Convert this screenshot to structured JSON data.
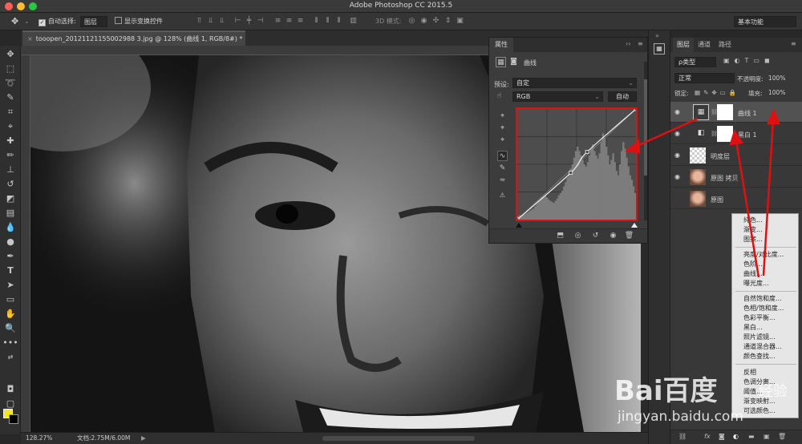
{
  "window": {
    "title": "Adobe Photoshop CC 2015.5"
  },
  "options_bar": {
    "auto_select_label": "自动选择:",
    "auto_select_value": "图层",
    "show_transform_label": "显示变换控件",
    "mode3d_label": "3D 模式:",
    "workspace": "基本功能"
  },
  "document": {
    "tab_title": "tooopen_20121121155002988 3.jpg @ 128% (曲线 1, RGB/8#) *",
    "zoom": "128.27%",
    "doc_size": "文档:2.75M/6.00M"
  },
  "properties": {
    "tab": "属性",
    "header": "曲线",
    "preset_label": "预设:",
    "preset_value": "自定",
    "channel": "RGB",
    "auto_button": "自动",
    "histogram": [
      3,
      4,
      4,
      5,
      5,
      6,
      7,
      8,
      9,
      10,
      12,
      14,
      16,
      18,
      20,
      21,
      22,
      20,
      18,
      17,
      16,
      15,
      17,
      19,
      22,
      24,
      26,
      30,
      34,
      38,
      42,
      46,
      50,
      56,
      62,
      66,
      62,
      58,
      54,
      50,
      48,
      52,
      58,
      64,
      68,
      62,
      58,
      55,
      60,
      70,
      78,
      74,
      66,
      58,
      50,
      54,
      60,
      52,
      44,
      40,
      50,
      62,
      70,
      64,
      56,
      48,
      40,
      36,
      30,
      24
    ],
    "curve_points": [
      [
        0,
        0
      ],
      [
        115,
        108
      ],
      [
        150,
        156
      ],
      [
        255,
        255
      ]
    ]
  },
  "layers_panel": {
    "tabs": [
      "图层",
      "通道",
      "路径"
    ],
    "filter_kind": "ρ类型",
    "blend_mode": "正常",
    "opacity_label": "不透明度:",
    "opacity_value": "100%",
    "lock_label": "锁定:",
    "fill_label": "填充:",
    "fill_value": "100%",
    "layers": [
      {
        "name": "曲线 1",
        "kind": "curves"
      },
      {
        "name": "黑白 1",
        "kind": "bw"
      },
      {
        "name": "明度层",
        "kind": "transparent"
      },
      {
        "name": "原图 拷贝",
        "kind": "photo"
      },
      {
        "name": "原图",
        "kind": "photo"
      }
    ]
  },
  "adjust_menu": {
    "group1": [
      "纯色...",
      "渐变...",
      "图案..."
    ],
    "group2": [
      "亮度/对比度...",
      "色阶...",
      "曲线...",
      "曝光度..."
    ],
    "group3": [
      "自然饱和度...",
      "色相/饱和度...",
      "色彩平衡...",
      "黑白...",
      "照片滤镜...",
      "通道混合器...",
      "颜色查找..."
    ],
    "group4": [
      "反相",
      "色调分离...",
      "阈值...",
      "渐变映射...",
      "可选颜色..."
    ]
  },
  "watermark": {
    "logo": "Bai百度",
    "sub": "经验",
    "url": "jingyan.baidu.com"
  },
  "colors": {
    "fg": "#f5e51b",
    "bg": "#000000",
    "highlight": "#e01010",
    "panel": "#3c3c3c"
  }
}
